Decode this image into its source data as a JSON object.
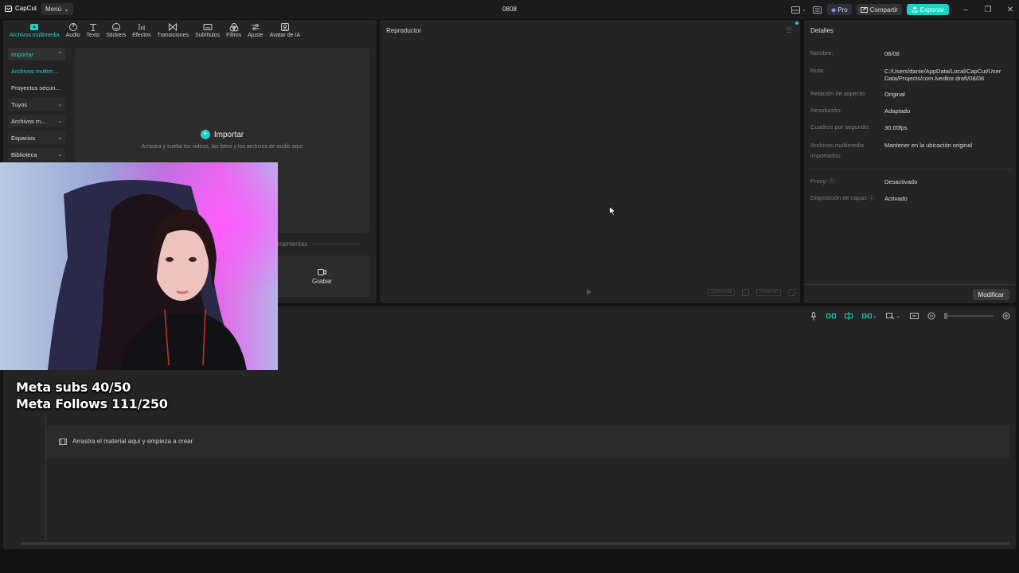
{
  "titlebar": {
    "logo_text": "CapCut",
    "menu_label": "Menú",
    "project_title": "0808",
    "pro_label": "Pro",
    "share_label": "Compartir",
    "export_label": "Exportar",
    "accent_color": "#1fcfc1"
  },
  "tools": {
    "tabs": [
      {
        "label": "Archivos multimedia",
        "icon": "media-icon",
        "active": true
      },
      {
        "label": "Audio",
        "icon": "audio-icon"
      },
      {
        "label": "Texto",
        "icon": "text-icon"
      },
      {
        "label": "Stickers",
        "icon": "sticker-icon"
      },
      {
        "label": "Efectos",
        "icon": "effects-icon"
      },
      {
        "label": "Transiciones",
        "icon": "transitions-icon"
      },
      {
        "label": "Subtítulos",
        "icon": "subtitles-icon"
      },
      {
        "label": "Filtros",
        "icon": "filters-icon"
      },
      {
        "label": "Ajuste",
        "icon": "adjust-icon"
      },
      {
        "label": "Avatar de IA",
        "icon": "ai-avatar-icon"
      }
    ]
  },
  "sidebar": {
    "items": [
      {
        "label": "Importar"
      },
      {
        "label": "Archivos multim..."
      },
      {
        "label": "Proyectos secun..."
      },
      {
        "label": "Tuyos"
      },
      {
        "label": "Archivos m..."
      },
      {
        "label": "Espacios"
      },
      {
        "label": "Biblioteca"
      }
    ]
  },
  "media": {
    "import_label": "Importar",
    "import_hint": "Arrastra y suelta los videos, las fotos y los archivos de audio aquí",
    "tools_label": "erramientas",
    "record_label": "Grabar"
  },
  "player": {
    "title": "Reproductor",
    "btn_full": "Completa",
    "btn_ratio": "Relación"
  },
  "details": {
    "title": "Detalles",
    "rows": [
      {
        "label": "Nombre:",
        "value": "08/08"
      },
      {
        "label": "Ruta:",
        "value": "C:/Users/danie/AppData/Local/CapCut/User Data/Projects/com.lveditor.draft/08/08"
      },
      {
        "label": "Relación de aspecto:",
        "value": "Original"
      },
      {
        "label": "Resolución:",
        "value": "Adaptado"
      },
      {
        "label": "Cuadros por segundo:",
        "value": "30.00fps"
      },
      {
        "label": "Archivos multimedia importados:",
        "value": "Mantener en la ubicación original"
      },
      {
        "label": "Proxy:",
        "value": "Desactivado"
      },
      {
        "label": "Disposición de capas",
        "value": "Activado"
      }
    ],
    "modify_label": "Modificar"
  },
  "timeline": {
    "drop_hint": "Arrastra el material aquí y empieza a crear",
    "zoom_level": 0
  },
  "overlay": {
    "line1": "Meta subs 40/50",
    "line2": "Meta Follows 111/250"
  }
}
